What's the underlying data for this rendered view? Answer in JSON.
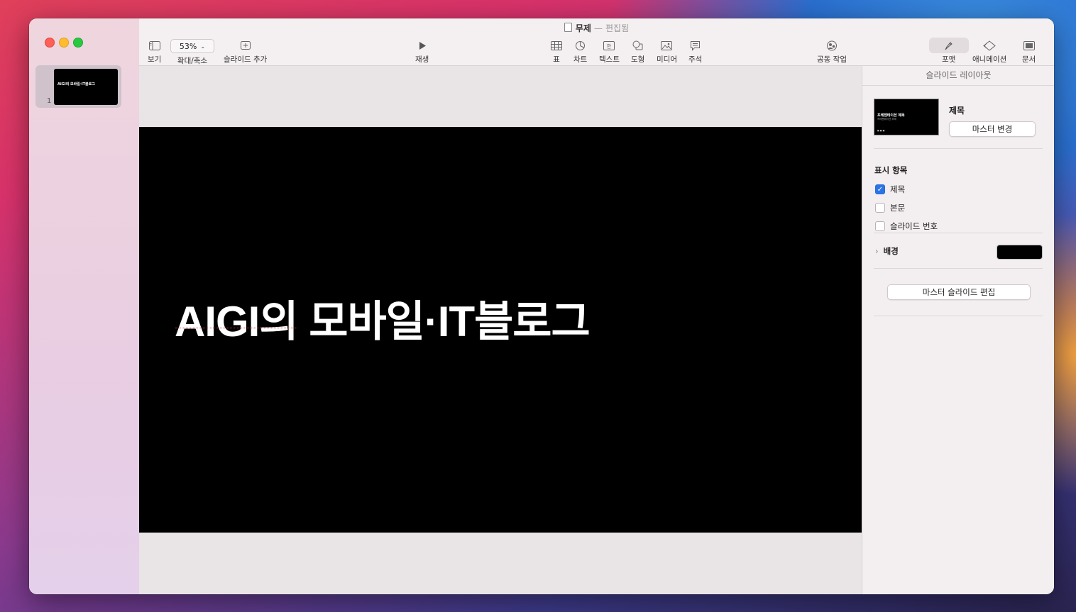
{
  "window": {
    "title": "무제",
    "title_sep": "—",
    "status": "편집됨"
  },
  "slides": [
    {
      "number": "1",
      "thumb_text": "AIGI의 모바일·IT블로그"
    }
  ],
  "toolbar": {
    "view": "보기",
    "zoom_value": "53%",
    "zoom_label": "확대/축소",
    "add_slide": "슬라이드 추가",
    "play": "재생",
    "table": "표",
    "chart": "차트",
    "text": "텍스트",
    "shape": "도형",
    "media": "미디어",
    "comment": "주석",
    "collaborate": "공동 작업",
    "format": "포맷",
    "animate": "애니메이션",
    "document": "문서"
  },
  "slide": {
    "title": "AIGI의 모바일·IT블로그"
  },
  "inspector": {
    "header": "슬라이드 레이아웃",
    "layout_thumb_title": "프레젠테이션 제목",
    "layout_thumb_subtitle": "프레젠테이션 부제",
    "layout_thumb_footer": "■ ■ ■",
    "master_name": "제목",
    "change_master": "마스터 변경",
    "appearance_label": "표시 항목",
    "checkboxes": [
      {
        "label": "제목",
        "checked": true
      },
      {
        "label": "본문",
        "checked": false
      },
      {
        "label": "슬라이드 번호",
        "checked": false
      }
    ],
    "background_label": "배경",
    "background_color": "#000000",
    "edit_master": "마스터 슬라이드 편집"
  },
  "colors": {
    "accent": "#2a74e6",
    "slide_bg": "#000000"
  }
}
